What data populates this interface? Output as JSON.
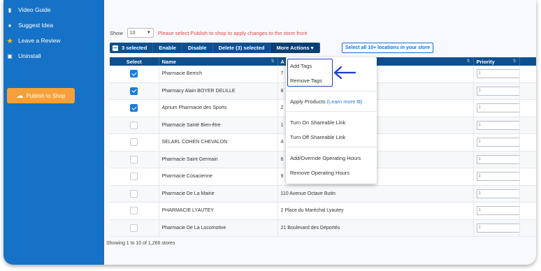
{
  "sidebar": {
    "items": [
      {
        "label": "Video Guide",
        "icon": "video-icon"
      },
      {
        "label": "Suggest Idea",
        "icon": "lightbulb-icon"
      },
      {
        "label": "Leave a Review",
        "icon": "star-icon"
      },
      {
        "label": "Uninstall",
        "icon": "trash-icon"
      }
    ],
    "publish_label": "Publish to Shop"
  },
  "controls": {
    "show_label": "Show",
    "show_value": "10",
    "warning": "Please select Publish to shop to apply changes to the store front"
  },
  "toolbar": {
    "selected": "3 selected",
    "enable": "Enable",
    "disable": "Disable",
    "delete": "Delete (3) selected",
    "more_actions": "More Actions ▾",
    "select_all": "Select all 10+ locations in your store"
  },
  "table": {
    "headers": {
      "select": "Select",
      "name": "Name",
      "address": "A",
      "priority": "Priority"
    },
    "rows": [
      {
        "selected": true,
        "name": "Pharmacie Berrich",
        "address": "7",
        "priority": "1"
      },
      {
        "selected": true,
        "name": "Pharmacy Alain BOYER DELILLE",
        "address": "8",
        "priority": "1"
      },
      {
        "selected": true,
        "name": "Aprium Pharmacie des Sports",
        "address": "2",
        "priority": "1"
      },
      {
        "selected": false,
        "name": "Pharmacie Santé Bien-être",
        "address": "1",
        "priority": "1"
      },
      {
        "selected": false,
        "name": "SELARL COHEN CHEVALON",
        "address": "4",
        "priority": "1"
      },
      {
        "selected": false,
        "name": "Pharmacie Saint Germain",
        "address": "6",
        "priority": "1"
      },
      {
        "selected": false,
        "name": "Pharmacie Cosacienne",
        "address": "9",
        "priority": "1"
      },
      {
        "selected": false,
        "name": "Pharmacie De La Mairie",
        "address": "110 Avenue Octave Butin",
        "priority": "1"
      },
      {
        "selected": false,
        "name": "PHARMACIE LYAUTEY",
        "address": "2 Place du Maréchal Lyautey",
        "priority": "1"
      },
      {
        "selected": false,
        "name": "Pharmacie De La Locomotive",
        "address": "21 Boulevard des Déportés",
        "priority": "1"
      }
    ]
  },
  "dropdown": {
    "add_tags": "Add Tags",
    "remove_tags": "Remove Tags",
    "apply_products": "Apply Products",
    "learn_more": "(Learn more ⧉)",
    "turn_on_link": "Turn On Shareable Link",
    "turn_off_link": "Turn Off Shareable Link",
    "add_hours": "Add/Override Operating Hours",
    "remove_hours": "Remove Operating Hours"
  },
  "footer": "Showing 1 to 10 of 1,266 stores",
  "colors": {
    "sidebar": "#1572c6",
    "header": "#0e4f8e",
    "publish": "#f5a13b",
    "warning": "#e24848",
    "highlight": "#1840c8"
  }
}
